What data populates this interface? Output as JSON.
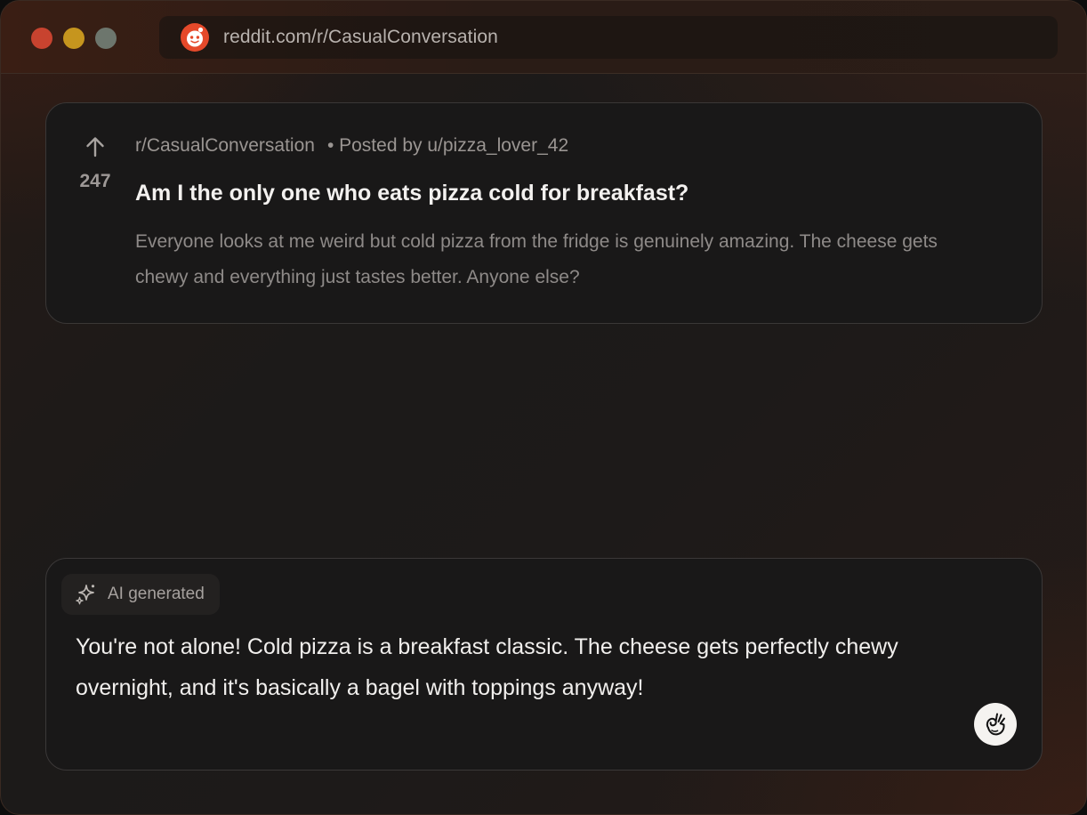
{
  "browser": {
    "url": "reddit.com/r/CasualConversation",
    "favicon": "reddit-icon",
    "colors": {
      "traffic_close": "#c8432f",
      "traffic_minimize": "#c6951e",
      "traffic_zoom": "#6d766d",
      "reddit_orange": "#e5492a"
    }
  },
  "post": {
    "upvote_icon": "arrow-up-icon",
    "vote_count": "247",
    "subreddit": "r/CasualConversation",
    "posted_by": "• Posted by u/pizza_lover_42",
    "title": "Am I the only one who eats pizza cold for breakfast?",
    "body": "Everyone looks at me weird but cold pizza from the fridge is genuinely amazing. The cheese gets chewy and everything just tastes better. Anyone else?"
  },
  "ai_reply": {
    "badge_icon": "sparkle-icon",
    "badge_label": "AI generated",
    "text": "You're not alone! Cold pizza is a breakfast classic. The cheese gets perfectly chewy overnight, and it's basically a bagel with toppings anyway!",
    "avatar_icon": "ok-hand-icon"
  }
}
